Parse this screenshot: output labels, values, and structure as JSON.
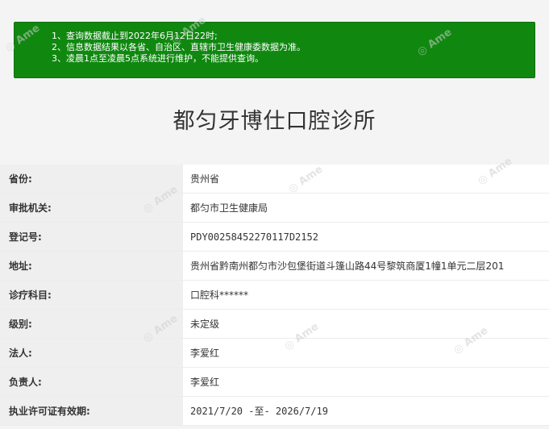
{
  "notice": {
    "lines": [
      "1、查询数据截止到2022年6月12日22时;",
      "2、信息数据结果以各省、自治区、直辖市卫生健康委数据为准。",
      "3、凌晨1点至凌晨5点系统进行维护，不能提供查询。"
    ]
  },
  "clinic": {
    "title": "都匀牙博仕口腔诊所"
  },
  "fields": [
    {
      "label": "省份:",
      "value": "贵州省"
    },
    {
      "label": "审批机关:",
      "value": "都匀市卫生健康局"
    },
    {
      "label": "登记号:",
      "value": "PDY00258452270117D2152"
    },
    {
      "label": "地址:",
      "value": "贵州省黔南州都匀市沙包堡街道斗篷山路44号黎筑商厦1幢1单元二层201"
    },
    {
      "label": "诊疗科目:",
      "value": "口腔科******"
    },
    {
      "label": "级别:",
      "value": "未定级"
    },
    {
      "label": "法人:",
      "value": "李爱红"
    },
    {
      "label": "负责人:",
      "value": "李爱红"
    },
    {
      "label": "执业许可证有效期:",
      "value": "2021/7/20 -至- 2026/7/19"
    }
  ],
  "colors": {
    "notice_bg": "#108810",
    "label_bg": "#efefef",
    "page_bg": "#f4f4f4"
  }
}
